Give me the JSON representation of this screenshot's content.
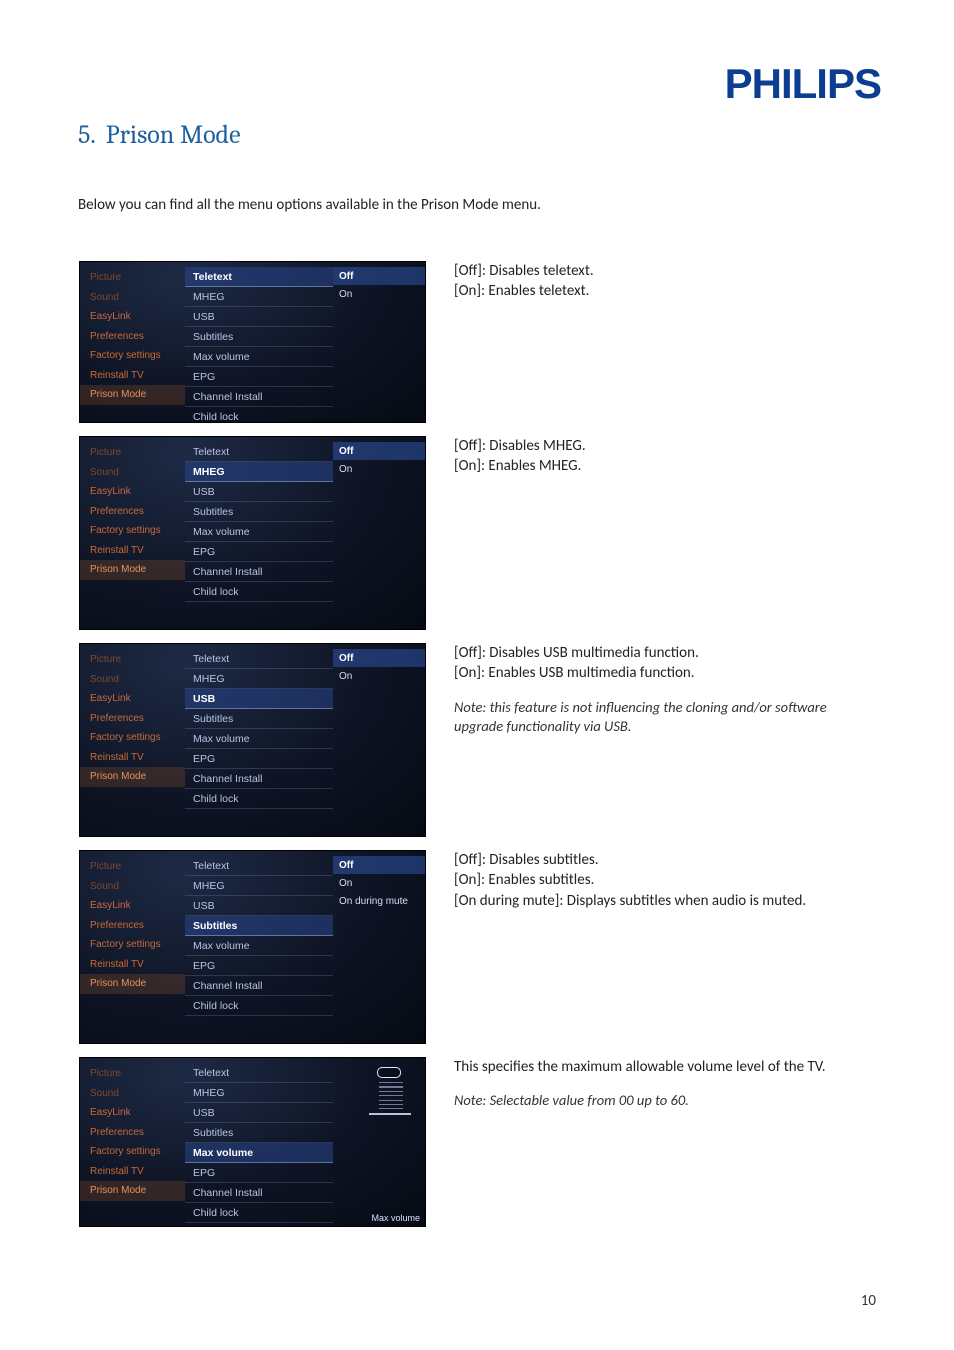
{
  "brand": "PHILIPS",
  "heading": {
    "number": "5.",
    "title": "Prison Mode"
  },
  "intro": "Below you can find all the menu options available in the Prison Mode menu.",
  "page_number": "10",
  "left_menu": {
    "items": [
      "Picture",
      "Sound",
      "EasyLink",
      "Preferences",
      "Factory settings",
      "Reinstall TV",
      "Prison Mode"
    ]
  },
  "mid_menu": {
    "items": [
      "Teletext",
      "MHEG",
      "USB",
      "Subtitles",
      "Max volume",
      "EPG",
      "Channel Install",
      "Child lock"
    ],
    "arrow_glyph": "▼"
  },
  "opts_onoff": {
    "off": "Off",
    "on": "On"
  },
  "opts_subtitles": {
    "off": "Off",
    "on": "On",
    "mute": "On during mute"
  },
  "slider_label": "Max volume",
  "rows": [
    {
      "selected_mid": "Teletext",
      "option_set": "onoff",
      "desc_lines": [
        "[Off]: Disables teletext.",
        "[On]: Enables teletext."
      ],
      "note": ""
    },
    {
      "selected_mid": "MHEG",
      "option_set": "onoff",
      "desc_lines": [
        "[Off]: Disables MHEG.",
        "[On]: Enables MHEG."
      ],
      "note": ""
    },
    {
      "selected_mid": "USB",
      "option_set": "onoff",
      "desc_lines": [
        "[Off]: Disables USB multimedia function.",
        "[On]: Enables USB multimedia function."
      ],
      "note": "Note: this feature is not influencing the cloning and/or software upgrade functionality via USB."
    },
    {
      "selected_mid": "Subtitles",
      "option_set": "subtitles",
      "desc_lines": [
        "[Off]: Disables subtitles.",
        "[On]: Enables subtitles.",
        "[On during mute]: Displays subtitles when audio is muted."
      ],
      "note": ""
    },
    {
      "selected_mid": "Max volume",
      "option_set": "slider",
      "desc_lines": [
        "This specifies the maximum allowable volume level of the TV."
      ],
      "note": "Note: Selectable value from 00 up to 60."
    }
  ]
}
